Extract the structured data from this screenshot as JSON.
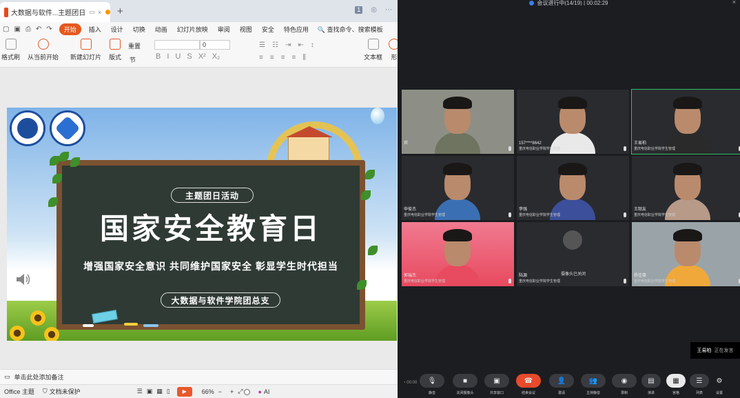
{
  "wps": {
    "tab": {
      "title": "大数据与软件...主题团日活动",
      "close": "×"
    },
    "titlebar_right": {
      "badge": "1"
    },
    "menu": {
      "items": [
        "开始",
        "插入",
        "设计",
        "切换",
        "动画",
        "幻灯片放映",
        "审阅",
        "视图",
        "安全",
        "特色应用"
      ],
      "active": "开始",
      "search": "查找命令、搜索模板"
    },
    "ribbon": {
      "format_painter": "格式刷",
      "from_current": "从当前开始",
      "new_slide": "新建幻灯片",
      "layout": "版式",
      "reset": "重置",
      "section": "节",
      "font_size": "0",
      "textbox": "文本框",
      "shape": "形"
    },
    "slide": {
      "subtitle_tag": "主题团日活动",
      "title": "国家安全教育日",
      "slogan": "增强国家安全意识  共同维护国家安全  彰显学生时代担当",
      "org": "大数据与软件学院团总支"
    },
    "notes": {
      "placeholder": "单击此处添加备注"
    },
    "status": {
      "theme": "Office 主题",
      "protect": "文档未保护",
      "zoom": "66%",
      "zoom_fraction": 0.26,
      "ai": "AI"
    }
  },
  "meeting": {
    "title": "会议进行中(14/19) | 00:02:29",
    "participants": [
      {
        "name": "宾",
        "org": "",
        "camera": true,
        "shirt": "#6f7460"
      },
      {
        "name": "157****8642",
        "org": "重庆电信职业学院学生管理",
        "camera": true,
        "shirt": "#e9e9e9"
      },
      {
        "name": "王易柏",
        "org": "重庆电信职业学院学生管理",
        "camera": true,
        "shirt": "#2a2a2a",
        "active": true
      },
      {
        "name": "申俊杰",
        "org": "重庆电信职业学院学生管理",
        "camera": true,
        "shirt": "#3b6fb3"
      },
      {
        "name": "李强",
        "org": "重庆电信职业学院学生管理",
        "camera": true,
        "shirt": "#3c4f9a"
      },
      {
        "name": "王韶友",
        "org": "重庆电信职业学院学生管理",
        "camera": true,
        "shirt": "#b79a88"
      },
      {
        "name": "郭瑞杰",
        "org": "重庆电信职业学院学生管理",
        "camera": true,
        "shirt": "#e84a5f"
      },
      {
        "name": "陆源",
        "org": "重庆电信职业学院学生管理",
        "camera": false,
        "camera_off_text": "摄像头已关闭"
      },
      {
        "name": "杨佳豪",
        "org": "重庆电信职业学院学生管理",
        "camera": true,
        "shirt": "#f0a83a"
      }
    ],
    "speaking": {
      "name": "王易柏",
      "status": "正在发言"
    },
    "controls": [
      {
        "label": "静音",
        "icon": "mic-icon"
      },
      {
        "label": "关闭摄像头",
        "icon": "camera-icon"
      },
      {
        "label": "共享窗口",
        "icon": "share-icon"
      },
      {
        "label": "结束会议",
        "icon": "hangup-icon"
      },
      {
        "label": "邀请",
        "icon": "invite-icon"
      },
      {
        "label": "主持静音",
        "icon": "members-icon"
      },
      {
        "label": "录制",
        "icon": "record-icon"
      },
      {
        "label": "演讲",
        "icon": "speaker-view-icon"
      },
      {
        "label": "宫格",
        "icon": "grid-view-icon"
      },
      {
        "label": "列表",
        "icon": "list-view-icon"
      },
      {
        "label": "设置",
        "icon": "settings-icon"
      }
    ],
    "signal": "00:00"
  }
}
